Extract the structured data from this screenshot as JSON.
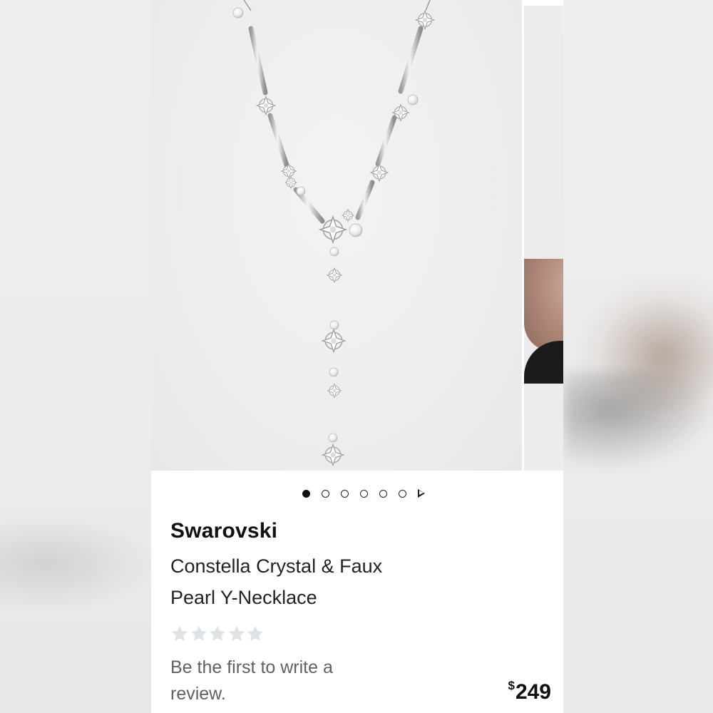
{
  "gallery": {
    "total_images": 6,
    "active_index": 0
  },
  "product": {
    "brand": "Swarovski",
    "name": "Constella Crystal & Faux Pearl Y-Necklace",
    "rating": {
      "stars_total": 5,
      "stars_filled": 0,
      "review_prompt": "Be the first to write a review."
    },
    "price": {
      "currency": "$",
      "amount": "249"
    }
  },
  "colors": {
    "star_empty": "#dfe3e6",
    "text_primary": "#111111",
    "text_secondary": "#5d6266"
  }
}
